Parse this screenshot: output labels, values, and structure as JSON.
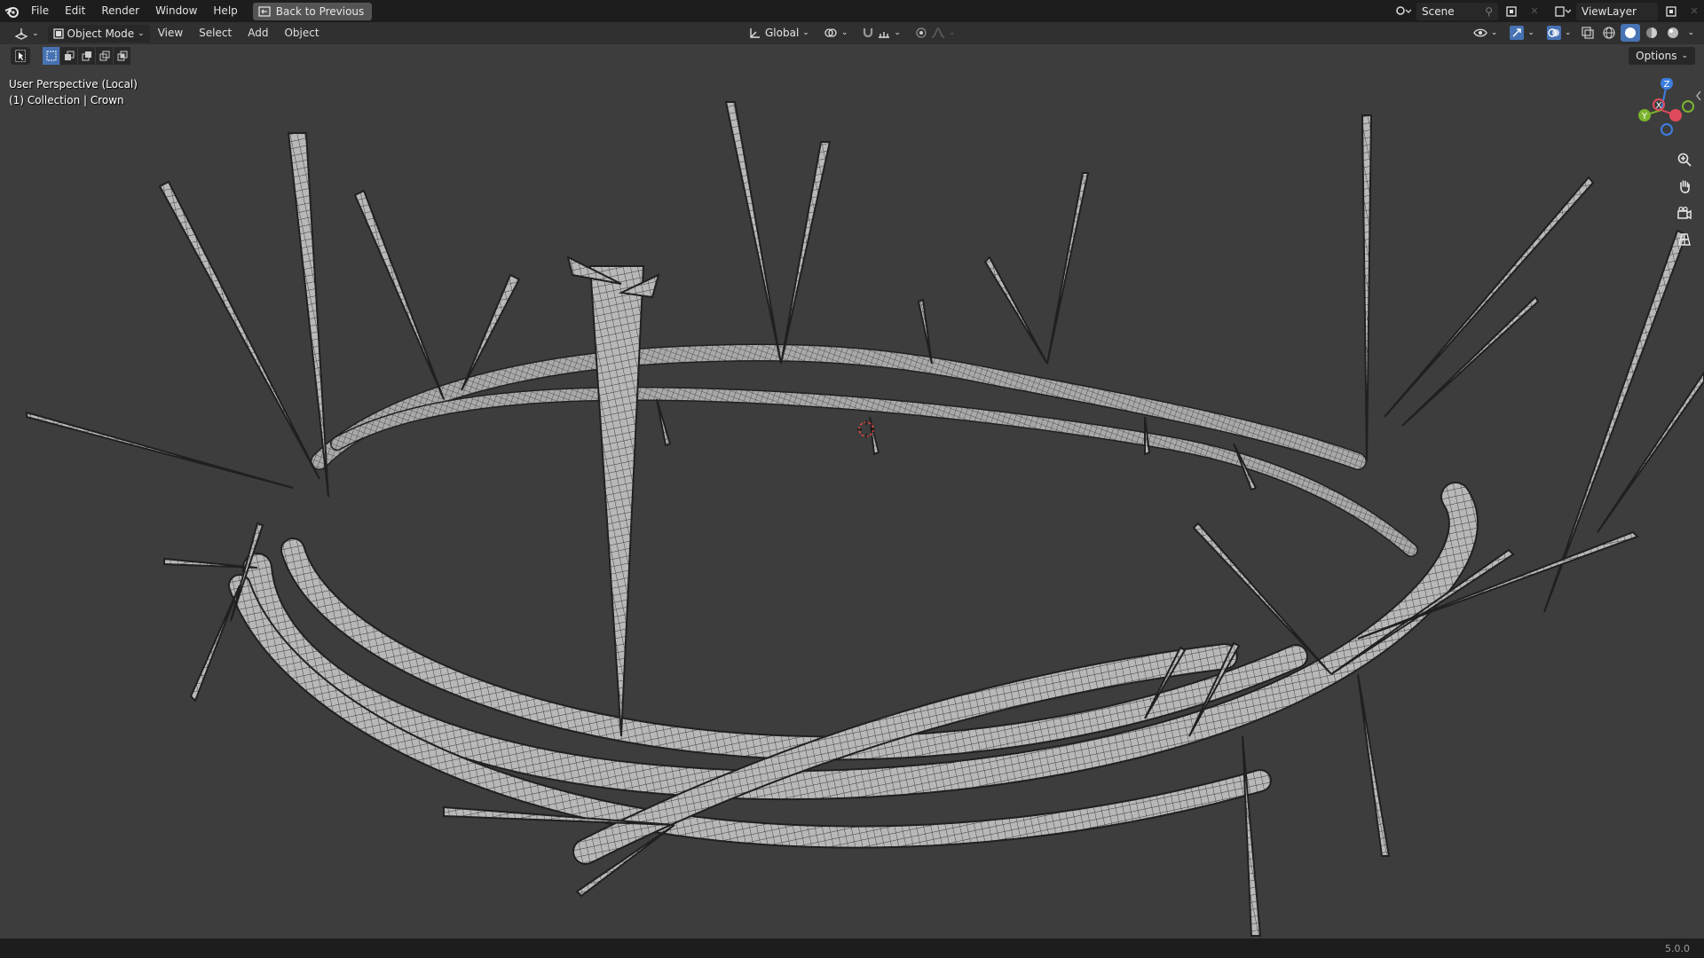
{
  "topbar": {
    "menus": [
      "File",
      "Edit",
      "Render",
      "Window",
      "Help"
    ],
    "back_button": "Back to Previous",
    "scene": "Scene",
    "view_layer": "ViewLayer"
  },
  "header": {
    "mode": "Object Mode",
    "menus": [
      "View",
      "Select",
      "Add",
      "Object"
    ],
    "transform_orientation": "Global"
  },
  "toolbar": {
    "options_label": "Options"
  },
  "viewport": {
    "perspective_label": "User Perspective (Local)",
    "collection_label": "(1) Collection | Crown",
    "gizmo_axes": [
      "Z",
      "X",
      "Y"
    ]
  },
  "status": {
    "version": "5.0.0"
  },
  "icons": {
    "blender": "blender-logo-icon",
    "editor_type": "3d-viewport-icon",
    "zoom": "zoom-icon",
    "pan": "hand-icon",
    "camera": "camera-icon",
    "grid": "grid-icon"
  },
  "colors": {
    "accent": "#4772b3",
    "axis_x": "#e04b5c",
    "axis_y": "#7bb32e",
    "axis_z": "#3d7ee0",
    "mesh": "#b8b8b8",
    "background": "#3d3d3d"
  }
}
